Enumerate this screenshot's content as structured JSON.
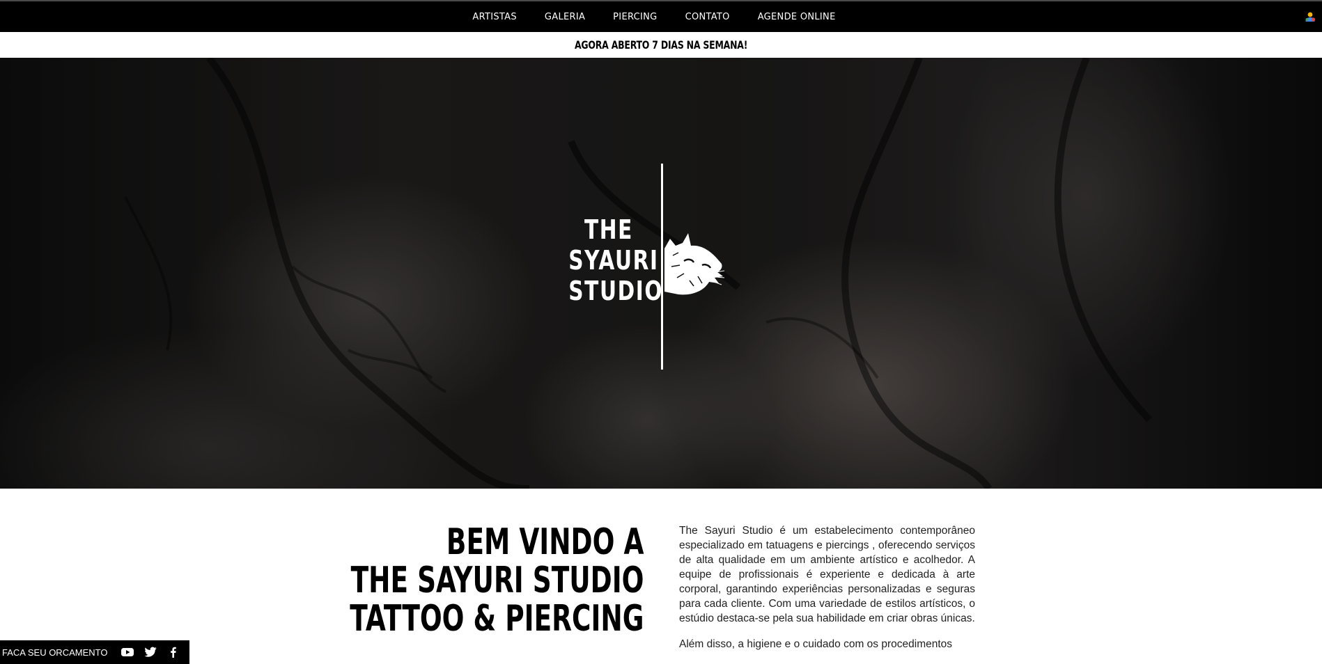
{
  "nav": {
    "items": [
      {
        "label": "ARTISTAS"
      },
      {
        "label": "GALERIA"
      },
      {
        "label": "PIERCING"
      },
      {
        "label": "CONTATO"
      },
      {
        "label": "AGENDE ONLINE"
      }
    ],
    "user_icon": "user-account-icon"
  },
  "promo": {
    "text": "AGORA ABERTO 7 DIAS NA SEMANA!"
  },
  "hero": {
    "brand_lines": [
      "THE",
      "SYAURI",
      "STUDIO"
    ],
    "logo_icon": "cat-logo-icon"
  },
  "welcome": {
    "title_lines": [
      "BEM VINDO A",
      "THE SAYURI STUDIO",
      "TATTOO & PIERCING"
    ],
    "paragraphs": [
      "The Sayuri Studio é um estabelecimento contemporâneo especializado em tatuagens e piercings , oferecendo serviços de alta qualidade em um ambiente artístico e acolhedor. A equipe de profissionais é experiente e dedicada à arte corporal, garantindo experiências personalizadas e seguras para cada cliente. Com uma variedade de estilos artísticos, o estúdio destaca-se pela sua habilidade em criar obras únicas.",
      "Além disso, a higiene e o cuidado com os procedimentos"
    ]
  },
  "quote_bar": {
    "label": "FACA SEU ORCAMENTO",
    "icons": [
      "youtube-icon",
      "twitter-icon",
      "facebook-icon"
    ]
  },
  "colors": {
    "nav_bg": "#000000",
    "text": "#000000",
    "hero_text": "#ffffff"
  }
}
